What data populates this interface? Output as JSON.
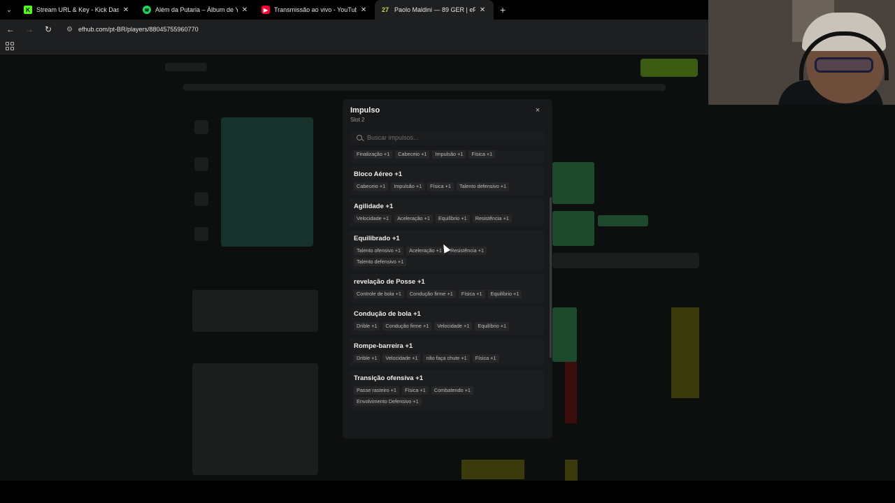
{
  "browser": {
    "tabs": [
      {
        "title": "Stream URL & Key - Kick Dashb",
        "favicon": "kick-icon",
        "color": "#53fc18",
        "active": false
      },
      {
        "title": "Além da Putaria – Álbum de Yu",
        "favicon": "spotify-icon",
        "color": "#1ed760",
        "active": false
      },
      {
        "title": "Transmissão ao vivo - YouTube",
        "favicon": "youtube-icon",
        "color": "#ff0033",
        "active": false
      },
      {
        "title": "Paolo Maldini — 89 GER | eFHU",
        "favicon": "efhub-icon",
        "color": "#c9d730",
        "badge": "27",
        "active": true
      }
    ],
    "url": "efhub.com/pt-BR/players/88045755960770"
  },
  "modal": {
    "title": "Impulso",
    "subtitle": "Slot 2",
    "search_placeholder": "Buscar impulsos...",
    "close_label": "×",
    "items": [
      {
        "name": "",
        "chips": [
          "Finalização +1",
          "Cabeceio +1",
          "Impulsão +1",
          "Física +1"
        ]
      },
      {
        "name": "Bloco Aéreo +1",
        "chips": [
          "Cabeceio +1",
          "Impulsão +1",
          "Física +1",
          "Talento defensivo +1"
        ]
      },
      {
        "name": "Agilidade +1",
        "chips": [
          "Velocidade +1",
          "Aceleração +1",
          "Equilíbrio +1",
          "Resistência +1"
        ]
      },
      {
        "name": "Equilibrado +1",
        "chips": [
          "Talento ofensivo +1",
          "Aceleração +1",
          "Resistência +1",
          "Talento defensivo +1"
        ]
      },
      {
        "name": "revelação de Posse +1",
        "chips": [
          "Controle de bola +1",
          "Condução firme +1",
          "Física +1",
          "Equilíbrio +1"
        ]
      },
      {
        "name": "Condução de bola +1",
        "chips": [
          "Drible +1",
          "Condução firme +1",
          "Velocidade +1",
          "Equilíbrio +1"
        ]
      },
      {
        "name": "Rompe-barreira +1",
        "chips": [
          "Drible +1",
          "Velocidade +1",
          "não faça chute +1",
          "Física +1"
        ]
      },
      {
        "name": "Transição ofensiva +1",
        "chips": [
          "Passe rasteiro +1",
          "Física +1",
          "Combatendo +1",
          "Envolvimento Defensivo +1"
        ]
      }
    ]
  }
}
